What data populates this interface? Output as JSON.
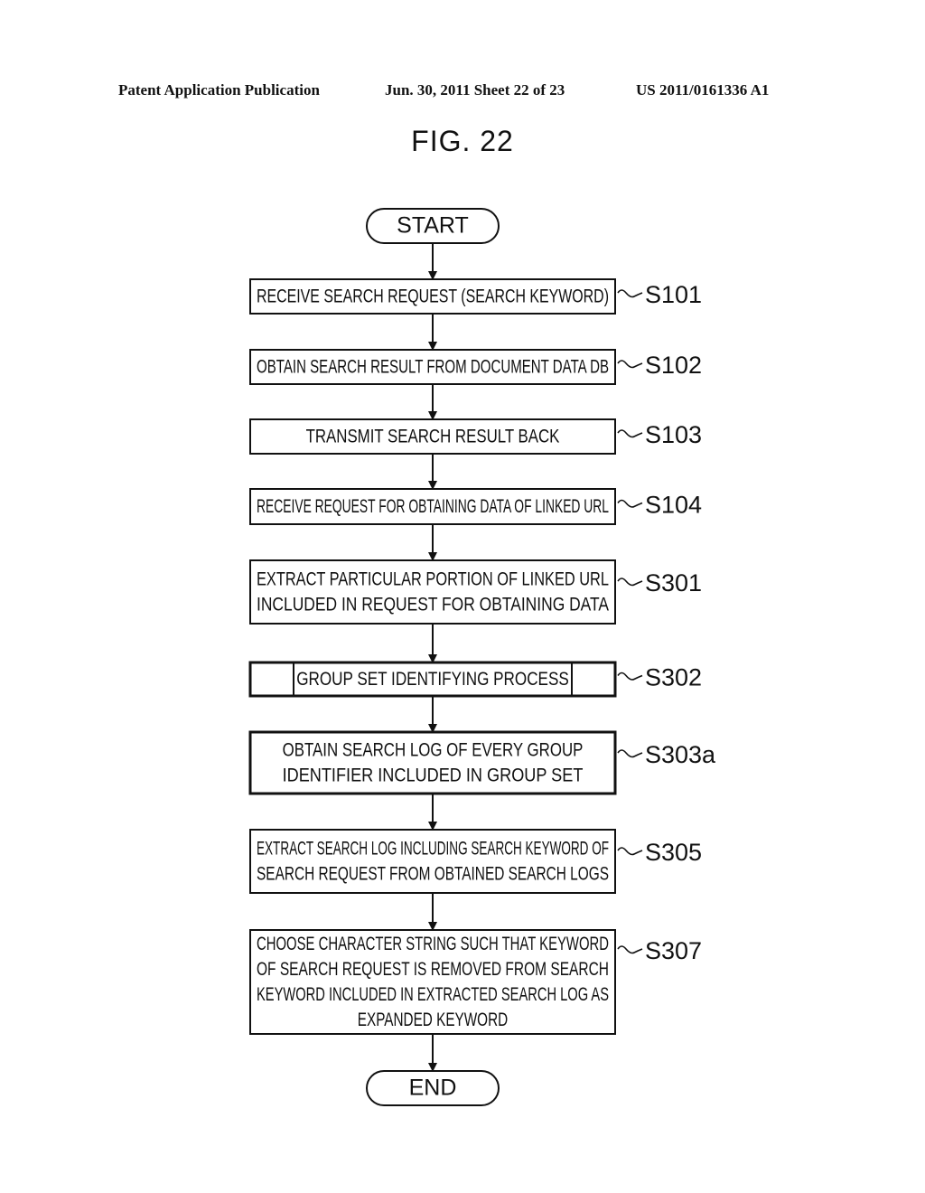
{
  "header": {
    "publication": "Patent Application Publication",
    "date_sheet": "Jun. 30, 2011  Sheet 22 of 23",
    "patent_number": "US 2011/0161336 A1"
  },
  "figure": {
    "title": "FIG. 22"
  },
  "flowchart": {
    "start": "START",
    "end": "END",
    "steps": [
      {
        "id": "S101",
        "lines": [
          "RECEIVE SEARCH REQUEST (SEARCH KEYWORD)"
        ],
        "type": "process"
      },
      {
        "id": "S102",
        "lines": [
          "OBTAIN SEARCH RESULT FROM DOCUMENT DATA DB"
        ],
        "type": "process"
      },
      {
        "id": "S103",
        "lines": [
          "TRANSMIT SEARCH RESULT BACK"
        ],
        "type": "process"
      },
      {
        "id": "S104",
        "lines": [
          "RECEIVE REQUEST FOR OBTAINING DATA OF LINKED URL"
        ],
        "type": "process"
      },
      {
        "id": "S301",
        "lines": [
          "EXTRACT PARTICULAR PORTION OF LINKED URL",
          "INCLUDED IN REQUEST FOR OBTAINING DATA"
        ],
        "type": "process"
      },
      {
        "id": "S302",
        "lines": [
          "GROUP SET IDENTIFYING PROCESS"
        ],
        "type": "subprocess"
      },
      {
        "id": "S303a",
        "lines": [
          "OBTAIN SEARCH LOG OF EVERY GROUP",
          "IDENTIFIER INCLUDED IN GROUP SET"
        ],
        "type": "process-bold"
      },
      {
        "id": "S305",
        "lines": [
          "EXTRACT SEARCH LOG INCLUDING SEARCH KEYWORD OF",
          "SEARCH REQUEST FROM OBTAINED SEARCH LOGS"
        ],
        "type": "process"
      },
      {
        "id": "S307",
        "lines": [
          "CHOOSE CHARACTER STRING SUCH THAT KEYWORD",
          "OF SEARCH REQUEST IS REMOVED FROM SEARCH",
          "KEYWORD INCLUDED IN EXTRACTED SEARCH LOG AS",
          "EXPANDED KEYWORD"
        ],
        "type": "process"
      }
    ]
  }
}
